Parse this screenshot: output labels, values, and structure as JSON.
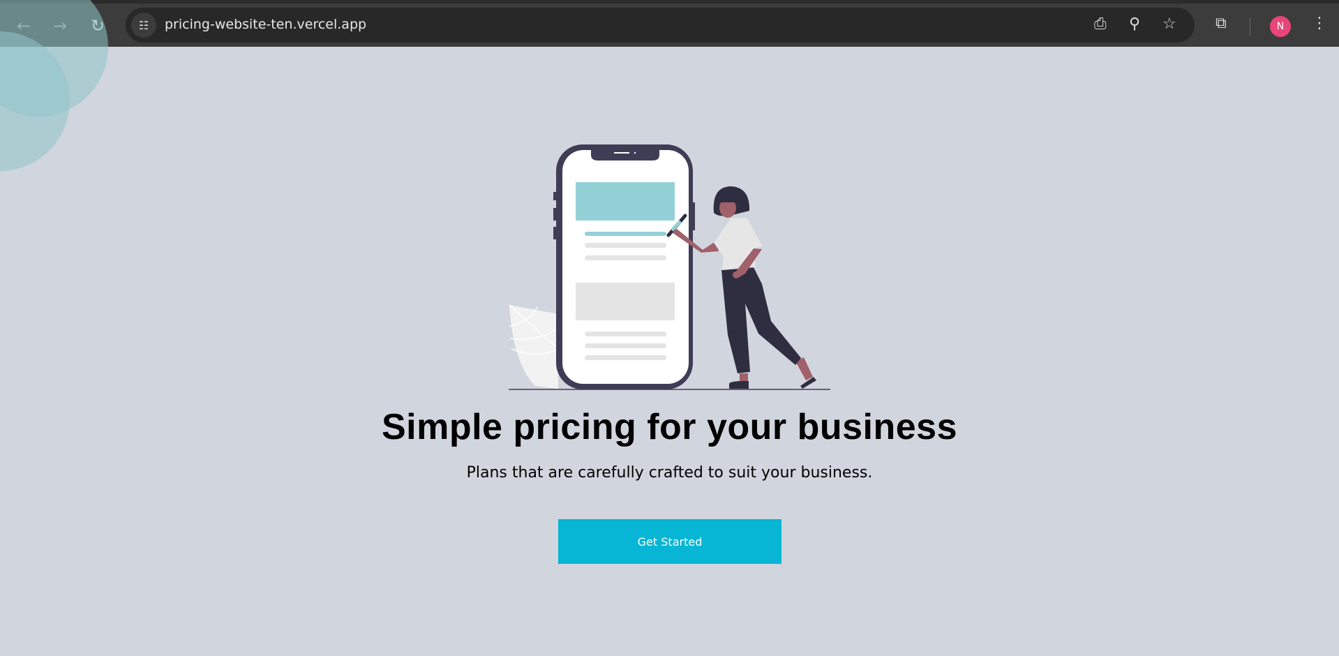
{
  "browser": {
    "url": "pricing-website-ten.vercel.app",
    "profile_initial": "N"
  },
  "hero": {
    "title": "Simple pricing for your business",
    "subtitle": "Plans that are carefully crafted to suit your business.",
    "cta": "Get Started"
  },
  "colors": {
    "accent": "#06b6d4",
    "background": "#d1d5de"
  }
}
